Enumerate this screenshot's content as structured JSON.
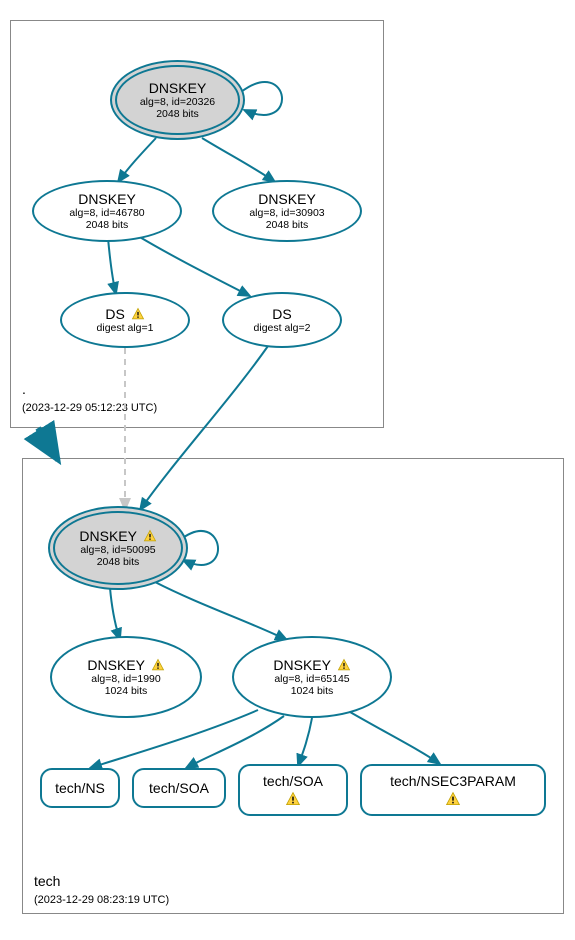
{
  "colors": {
    "stroke": "#0e7893",
    "ksk_fill": "#d3d3d3",
    "warn_fill": "#ffd23f",
    "warn_border": "#bfa000"
  },
  "zones": {
    "root": {
      "name": ".",
      "timestamp": "(2023-12-29 05:12:23 UTC)"
    },
    "tech": {
      "name": "tech",
      "timestamp": "(2023-12-29 08:23:19 UTC)"
    }
  },
  "nodes": {
    "root_ksk": {
      "title": "DNSKEY",
      "line2": "alg=8, id=20326",
      "line3": "2048 bits"
    },
    "root_zsk1": {
      "title": "DNSKEY",
      "line2": "alg=8, id=46780",
      "line3": "2048 bits"
    },
    "root_zsk2": {
      "title": "DNSKEY",
      "line2": "alg=8, id=30903",
      "line3": "2048 bits"
    },
    "ds1": {
      "title": "DS",
      "line2": "digest alg=1",
      "warn": true
    },
    "ds2": {
      "title": "DS",
      "line2": "digest alg=2"
    },
    "tech_ksk": {
      "title": "DNSKEY",
      "line2": "alg=8, id=50095",
      "line3": "2048 bits",
      "warn": true
    },
    "tech_zsk1": {
      "title": "DNSKEY",
      "line2": "alg=8, id=1990",
      "line3": "1024 bits",
      "warn": true
    },
    "tech_zsk2": {
      "title": "DNSKEY",
      "line2": "alg=8, id=65145",
      "line3": "1024 bits",
      "warn": true
    },
    "rr_ns": {
      "title": "tech/NS"
    },
    "rr_soa": {
      "title": "tech/SOA"
    },
    "rr_soa2": {
      "title": "tech/SOA",
      "warn": true
    },
    "rr_nsec3": {
      "title": "tech/NSEC3PARAM",
      "warn": true
    }
  }
}
